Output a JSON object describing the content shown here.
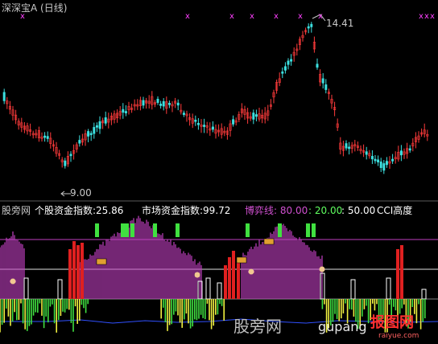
{
  "top_panel": {
    "title": "深深宝A (日线)",
    "high_label": "14.41",
    "low_label": "9.00",
    "colors": {
      "up": "#ff3b3b",
      "down": "#3ce0e0",
      "title": "#c8c8c8",
      "marker": "#ff40ff"
    }
  },
  "indicator_panel": {
    "name": "股旁网",
    "items": [
      {
        "label": "个股资金指数:",
        "value": "25.86",
        "color": "#ffffff"
      },
      {
        "label": "市场资金指数:",
        "value": "99.72",
        "color": "#ffffff"
      },
      {
        "label": "博弈线:",
        "value": "80.00",
        "color": "#d050d0"
      },
      {
        "label": "",
        "value": ": 20.00",
        "color": "#60ff60"
      },
      {
        "label": "",
        "value": ": 50.00",
        "color": "#ffffff"
      },
      {
        "label": "",
        "value": "CCI高度",
        "color": "#ffffff"
      }
    ],
    "reference_levels": [
      80,
      50,
      20
    ],
    "colors": {
      "purple": "#c040c0",
      "red": "#e02020",
      "green": "#40e040",
      "yellow": "#f0f040",
      "white": "#ffffff"
    }
  },
  "watermark": {
    "text1": "股旁网",
    "text2": "gupang",
    "text3": "报图网",
    "text4": "raiyue.com"
  }
}
